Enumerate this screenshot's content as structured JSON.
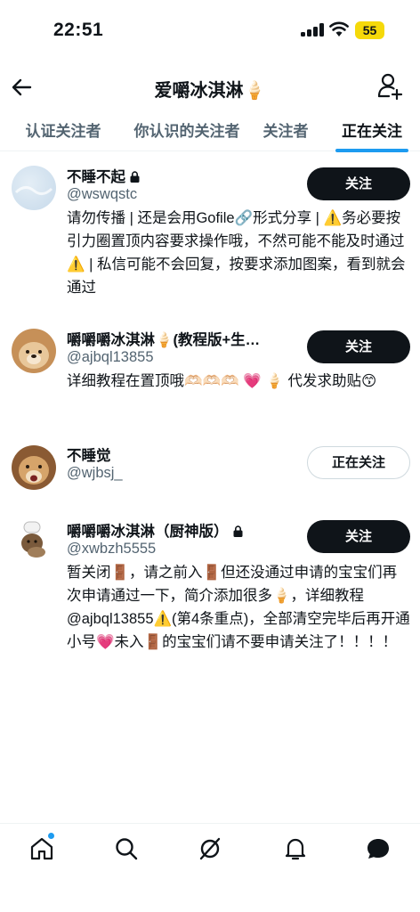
{
  "status_bar": {
    "time": "22:51",
    "battery": "55"
  },
  "header": {
    "title": "爱嚼冰淇淋🍦"
  },
  "tabs": [
    {
      "label": "认证关注者",
      "active": false
    },
    {
      "label": "你认识的关注者",
      "active": false
    },
    {
      "label": "关注者",
      "active": false
    },
    {
      "label": "正在关注",
      "active": true
    }
  ],
  "users": [
    {
      "name": "不睡不起",
      "handle": "@wswqstc",
      "protected": true,
      "button": "关注",
      "bio": "请勿传播 | 还是会用Gofile🔗形式分享 | ⚠️务必要按引力圈置顶内容要求操作哦，不然可能不能及时通过⚠️ | 私信可能不会回复，按要求添加图案，看到就会通过"
    },
    {
      "name": "嚼嚼嚼冰淇淋🍦(教程版+生…",
      "handle": "@ajbql13855",
      "protected": false,
      "button": "关注",
      "bio": "详细教程在置顶哦🫶🏻🫶🏻🫶🏻 💗 🍦 代发求助贴😙"
    },
    {
      "name": "不睡觉",
      "handle": "@wjbsj_",
      "protected": false,
      "button": "正在关注",
      "bio": ""
    },
    {
      "name": "嚼嚼嚼冰淇淋（厨神版）",
      "handle": "@xwbzh5555",
      "protected": true,
      "button": "关注",
      "bio": "暂关闭🚪，请之前入🚪但还没通过申请的宝宝们再次申请通过一下，简介添加很多🍦，详细教程@ajbql13855⚠️(第4条重点)，全部清空完毕后再开通小号💗未入🚪的宝宝们请不要申请关注了！！！！"
    }
  ],
  "nav": [
    "home-icon",
    "search-icon",
    "grok-icon",
    "notifications-icon",
    "messages-icon"
  ]
}
